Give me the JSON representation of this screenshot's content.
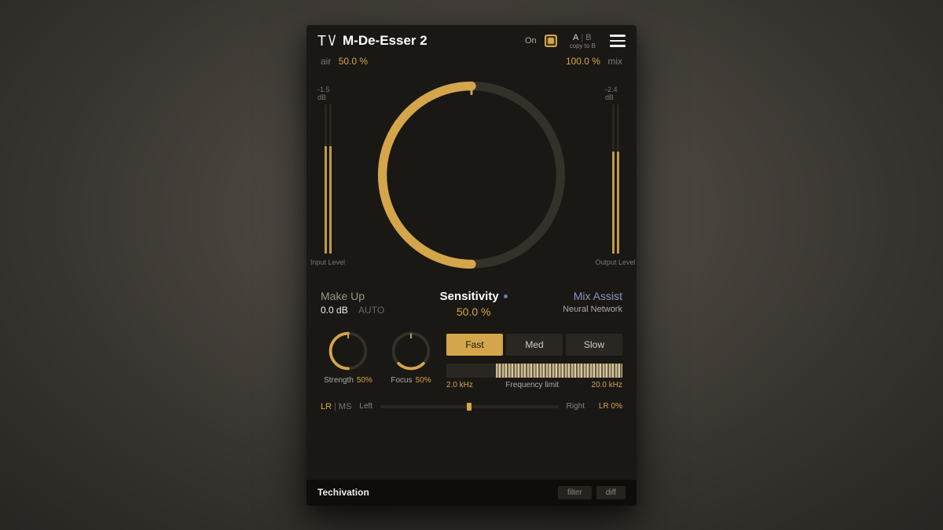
{
  "header": {
    "title": "M-De-Esser 2",
    "on_label": "On",
    "ab_a": "A",
    "ab_b": "B",
    "ab_copy": "copy to B"
  },
  "air": {
    "label": "air",
    "value": "50.0 %"
  },
  "mix": {
    "label": "mix",
    "value": "100.0 %"
  },
  "meters": {
    "input_db": "-1.5 dB",
    "input_label": "Input Level",
    "output_db": "-2.4 dB",
    "output_label": "Output Level"
  },
  "makeup": {
    "title": "Make Up",
    "value": "0.0 dB",
    "auto": "AUTO"
  },
  "sensitivity": {
    "title": "Sensitivity",
    "value": "50.0 %"
  },
  "mixassist": {
    "title": "Mix Assist",
    "sub": "Neural Network"
  },
  "knobs": {
    "strength": {
      "label": "Strength",
      "value": "50%"
    },
    "focus": {
      "label": "Focus",
      "value": "50%"
    }
  },
  "speed": {
    "fast": "Fast",
    "med": "Med",
    "slow": "Slow",
    "active": "fast"
  },
  "freq": {
    "low": "2.0 kHz",
    "label": "Frequency limit",
    "high": "20.0 kHz"
  },
  "lr": {
    "lr": "LR",
    "ms": "MS",
    "left": "Left",
    "right": "Right",
    "value": "LR 0%"
  },
  "footer": {
    "brand": "Techivation",
    "filter": "filter",
    "diff": "diff"
  }
}
